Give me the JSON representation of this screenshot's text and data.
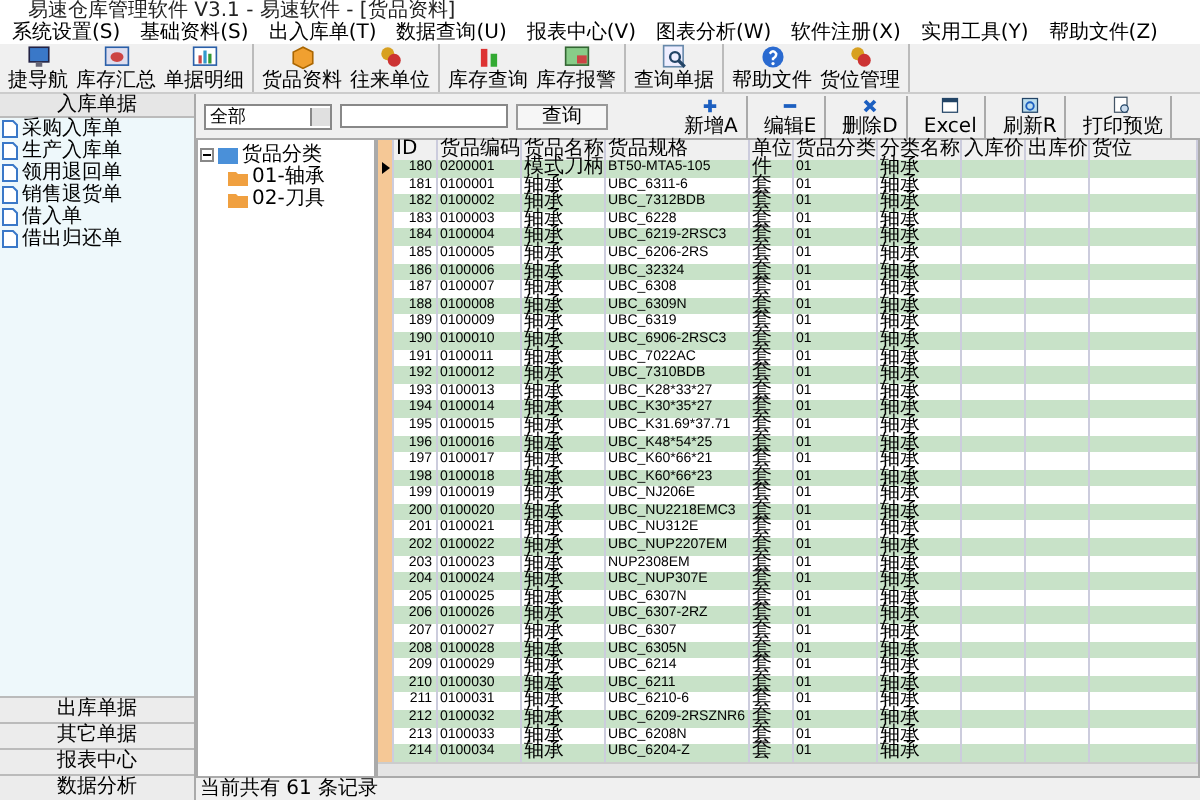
{
  "window": {
    "title": "易速仓库管理软件 V3.1 - 易速软件 - [货品资料]"
  },
  "menu": [
    {
      "label": "系统设置(S)"
    },
    {
      "label": "基础资料(S)"
    },
    {
      "label": "出入库单(T)"
    },
    {
      "label": "数据查询(U)"
    },
    {
      "label": "报表中心(V)"
    },
    {
      "label": "图表分析(W)"
    },
    {
      "label": "软件注册(X)"
    },
    {
      "label": "实用工具(Y)"
    },
    {
      "label": "帮助文件(Z)"
    }
  ],
  "toolbar": [
    [
      {
        "label": "捷导航"
      },
      {
        "label": "库存汇总"
      },
      {
        "label": "单据明细"
      }
    ],
    [
      {
        "label": "货品资料"
      },
      {
        "label": "往来单位"
      }
    ],
    [
      {
        "label": "库存查询"
      },
      {
        "label": "库存报警"
      }
    ],
    [
      {
        "label": "查询单据"
      }
    ],
    [
      {
        "label": "帮助文件"
      },
      {
        "label": "货位管理"
      }
    ]
  ],
  "sidebar": {
    "open_section": "入库单据",
    "items": [
      {
        "label": "采购入库单"
      },
      {
        "label": "生产入库单"
      },
      {
        "label": "领用退回单"
      },
      {
        "label": "销售退货单"
      },
      {
        "label": "借入单"
      },
      {
        "label": "借出归还单"
      }
    ],
    "sections": [
      "出库单据",
      "其它单据",
      "报表中心",
      "数据分析"
    ]
  },
  "filter": {
    "category": "全部",
    "search_button": "查询"
  },
  "actions": [
    {
      "label": "新增A"
    },
    {
      "label": "编辑E"
    },
    {
      "label": "删除D"
    },
    {
      "label": "Excel"
    },
    {
      "label": "刷新R"
    },
    {
      "label": "打印预览"
    }
  ],
  "tree": {
    "label": "货品分类",
    "expanded": true,
    "children": [
      {
        "label": "01-轴承"
      },
      {
        "label": "02-刀具"
      }
    ]
  },
  "table": {
    "columns": [
      "ID",
      "货品编码",
      "货品名称",
      "货品规格",
      "单位",
      "货品分类",
      "分类名称",
      "入库价",
      "出库价",
      "货位"
    ],
    "rows": [
      {
        "selected": true,
        "id": "180",
        "code": "0200001",
        "name": "模式刀柄",
        "spec": "BT50-MTA5-105",
        "unit": "件",
        "category": "01",
        "category_name": "轴承"
      },
      {
        "selected": false,
        "id": "181",
        "code": "0100001",
        "name": "轴承",
        "spec": "UBC_6311-6",
        "unit": "套",
        "category": "01",
        "category_name": "轴承"
      },
      {
        "selected": false,
        "id": "182",
        "code": "0100002",
        "name": "轴承",
        "spec": "UBC_7312BDB",
        "unit": "套",
        "category": "01",
        "category_name": "轴承"
      },
      {
        "selected": false,
        "id": "183",
        "code": "0100003",
        "name": "轴承",
        "spec": "UBC_6228",
        "unit": "套",
        "category": "01",
        "category_name": "轴承"
      },
      {
        "selected": false,
        "id": "184",
        "code": "0100004",
        "name": "轴承",
        "spec": "UBC_6219-2RSC3",
        "unit": "套",
        "category": "01",
        "category_name": "轴承"
      },
      {
        "selected": false,
        "id": "185",
        "code": "0100005",
        "name": "轴承",
        "spec": "UBC_6206-2RS",
        "unit": "套",
        "category": "01",
        "category_name": "轴承"
      },
      {
        "selected": false,
        "id": "186",
        "code": "0100006",
        "name": "轴承",
        "spec": "UBC_32324",
        "unit": "套",
        "category": "01",
        "category_name": "轴承"
      },
      {
        "selected": false,
        "id": "187",
        "code": "0100007",
        "name": "轴承",
        "spec": "UBC_6308",
        "unit": "套",
        "category": "01",
        "category_name": "轴承"
      },
      {
        "selected": false,
        "id": "188",
        "code": "0100008",
        "name": "轴承",
        "spec": "UBC_6309N",
        "unit": "套",
        "category": "01",
        "category_name": "轴承"
      },
      {
        "selected": false,
        "id": "189",
        "code": "0100009",
        "name": "轴承",
        "spec": "UBC_6319",
        "unit": "套",
        "category": "01",
        "category_name": "轴承"
      },
      {
        "selected": false,
        "id": "190",
        "code": "0100010",
        "name": "轴承",
        "spec": "UBC_6906-2RSC3",
        "unit": "套",
        "category": "01",
        "category_name": "轴承"
      },
      {
        "selected": false,
        "id": "191",
        "code": "0100011",
        "name": "轴承",
        "spec": "UBC_7022AC",
        "unit": "套",
        "category": "01",
        "category_name": "轴承"
      },
      {
        "selected": false,
        "id": "192",
        "code": "0100012",
        "name": "轴承",
        "spec": "UBC_7310BDB",
        "unit": "套",
        "category": "01",
        "category_name": "轴承"
      },
      {
        "selected": false,
        "id": "193",
        "code": "0100013",
        "name": "轴承",
        "spec": "UBC_K28*33*27",
        "unit": "套",
        "category": "01",
        "category_name": "轴承"
      },
      {
        "selected": false,
        "id": "194",
        "code": "0100014",
        "name": "轴承",
        "spec": "UBC_K30*35*27",
        "unit": "套",
        "category": "01",
        "category_name": "轴承"
      },
      {
        "selected": false,
        "id": "195",
        "code": "0100015",
        "name": "轴承",
        "spec": "UBC_K31.69*37.71",
        "unit": "套",
        "category": "01",
        "category_name": "轴承"
      },
      {
        "selected": false,
        "id": "196",
        "code": "0100016",
        "name": "轴承",
        "spec": "UBC_K48*54*25",
        "unit": "套",
        "category": "01",
        "category_name": "轴承"
      },
      {
        "selected": false,
        "id": "197",
        "code": "0100017",
        "name": "轴承",
        "spec": "UBC_K60*66*21",
        "unit": "套",
        "category": "01",
        "category_name": "轴承"
      },
      {
        "selected": false,
        "id": "198",
        "code": "0100018",
        "name": "轴承",
        "spec": "UBC_K60*66*23",
        "unit": "套",
        "category": "01",
        "category_name": "轴承"
      },
      {
        "selected": false,
        "id": "199",
        "code": "0100019",
        "name": "轴承",
        "spec": "UBC_NJ206E",
        "unit": "套",
        "category": "01",
        "category_name": "轴承"
      },
      {
        "selected": false,
        "id": "200",
        "code": "0100020",
        "name": "轴承",
        "spec": "UBC_NU2218EMC3",
        "unit": "套",
        "category": "01",
        "category_name": "轴承"
      },
      {
        "selected": false,
        "id": "201",
        "code": "0100021",
        "name": "轴承",
        "spec": "UBC_NU312E",
        "unit": "套",
        "category": "01",
        "category_name": "轴承"
      },
      {
        "selected": false,
        "id": "202",
        "code": "0100022",
        "name": "轴承",
        "spec": "UBC_NUP2207EM",
        "unit": "套",
        "category": "01",
        "category_name": "轴承"
      },
      {
        "selected": false,
        "id": "203",
        "code": "0100023",
        "name": "轴承",
        "spec": "NUP2308EM",
        "unit": "套",
        "category": "01",
        "category_name": "轴承"
      },
      {
        "selected": false,
        "id": "204",
        "code": "0100024",
        "name": "轴承",
        "spec": "UBC_NUP307E",
        "unit": "套",
        "category": "01",
        "category_name": "轴承"
      },
      {
        "selected": false,
        "id": "205",
        "code": "0100025",
        "name": "轴承",
        "spec": "UBC_6307N",
        "unit": "套",
        "category": "01",
        "category_name": "轴承"
      },
      {
        "selected": false,
        "id": "206",
        "code": "0100026",
        "name": "轴承",
        "spec": "UBC_6307-2RZ",
        "unit": "套",
        "category": "01",
        "category_name": "轴承"
      },
      {
        "selected": false,
        "id": "207",
        "code": "0100027",
        "name": "轴承",
        "spec": "UBC_6307",
        "unit": "套",
        "category": "01",
        "category_name": "轴承"
      },
      {
        "selected": false,
        "id": "208",
        "code": "0100028",
        "name": "轴承",
        "spec": "UBC_6305N",
        "unit": "套",
        "category": "01",
        "category_name": "轴承"
      },
      {
        "selected": false,
        "id": "209",
        "code": "0100029",
        "name": "轴承",
        "spec": "UBC_6214",
        "unit": "套",
        "category": "01",
        "category_name": "轴承"
      },
      {
        "selected": false,
        "id": "210",
        "code": "0100030",
        "name": "轴承",
        "spec": "UBC_6211",
        "unit": "套",
        "category": "01",
        "category_name": "轴承"
      },
      {
        "selected": false,
        "id": "211",
        "code": "0100031",
        "name": "轴承",
        "spec": "UBC_6210-6",
        "unit": "套",
        "category": "01",
        "category_name": "轴承"
      },
      {
        "selected": false,
        "id": "212",
        "code": "0100032",
        "name": "轴承",
        "spec": "UBC_6209-2RSZNR6",
        "unit": "套",
        "category": "01",
        "category_name": "轴承"
      },
      {
        "selected": false,
        "id": "213",
        "code": "0100033",
        "name": "轴承",
        "spec": "UBC_6208N",
        "unit": "套",
        "category": "01",
        "category_name": "轴承"
      },
      {
        "selected": false,
        "id": "214",
        "code": "0100034",
        "name": "轴承",
        "spec": "UBC_6204-Z",
        "unit": "套",
        "category": "01",
        "category_name": "轴承"
      }
    ]
  },
  "status_bar": "当前共有 61 条记录"
}
